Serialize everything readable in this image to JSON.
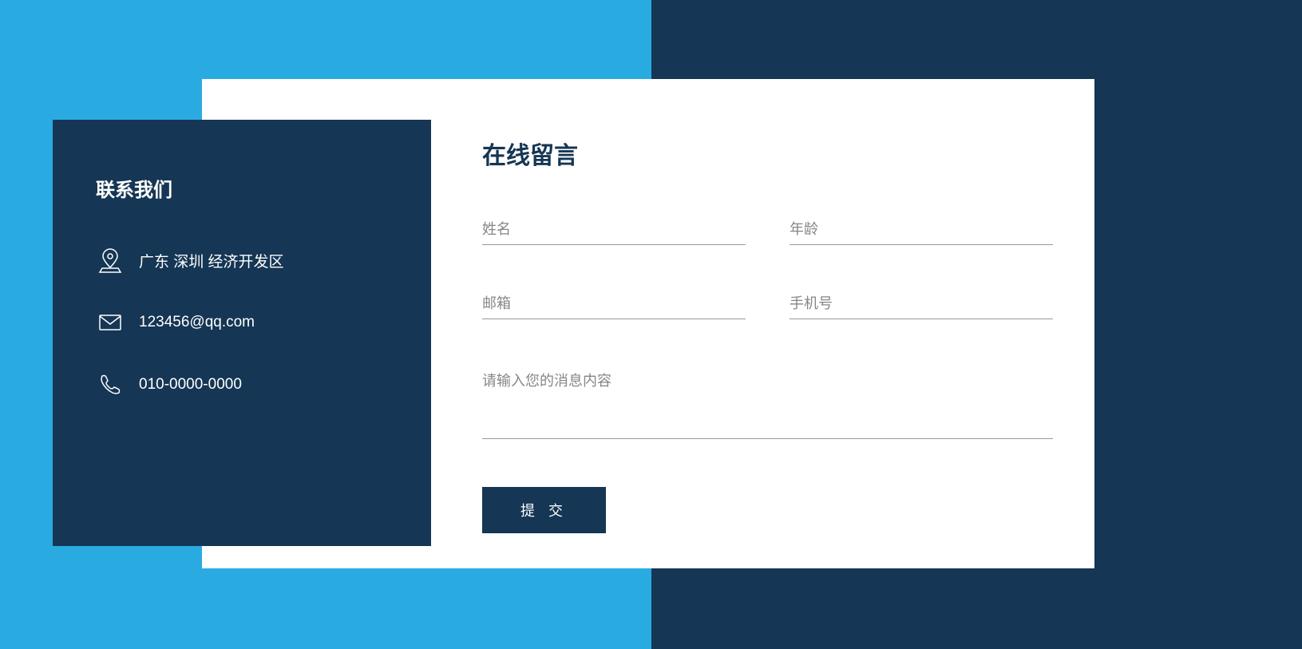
{
  "contact": {
    "title": "联系我们",
    "address": "广东 深圳 经济开发区",
    "email": "123456@qq.com",
    "phone": "010-0000-0000"
  },
  "form": {
    "title": "在线留言",
    "name_placeholder": "姓名",
    "age_placeholder": "年龄",
    "email_placeholder": "邮箱",
    "phone_placeholder": "手机号",
    "message_placeholder": "请输入您的消息内容",
    "submit_label": "提 交"
  },
  "colors": {
    "blue_light": "#29abe2",
    "blue_dark": "#153654",
    "white": "#ffffff"
  }
}
